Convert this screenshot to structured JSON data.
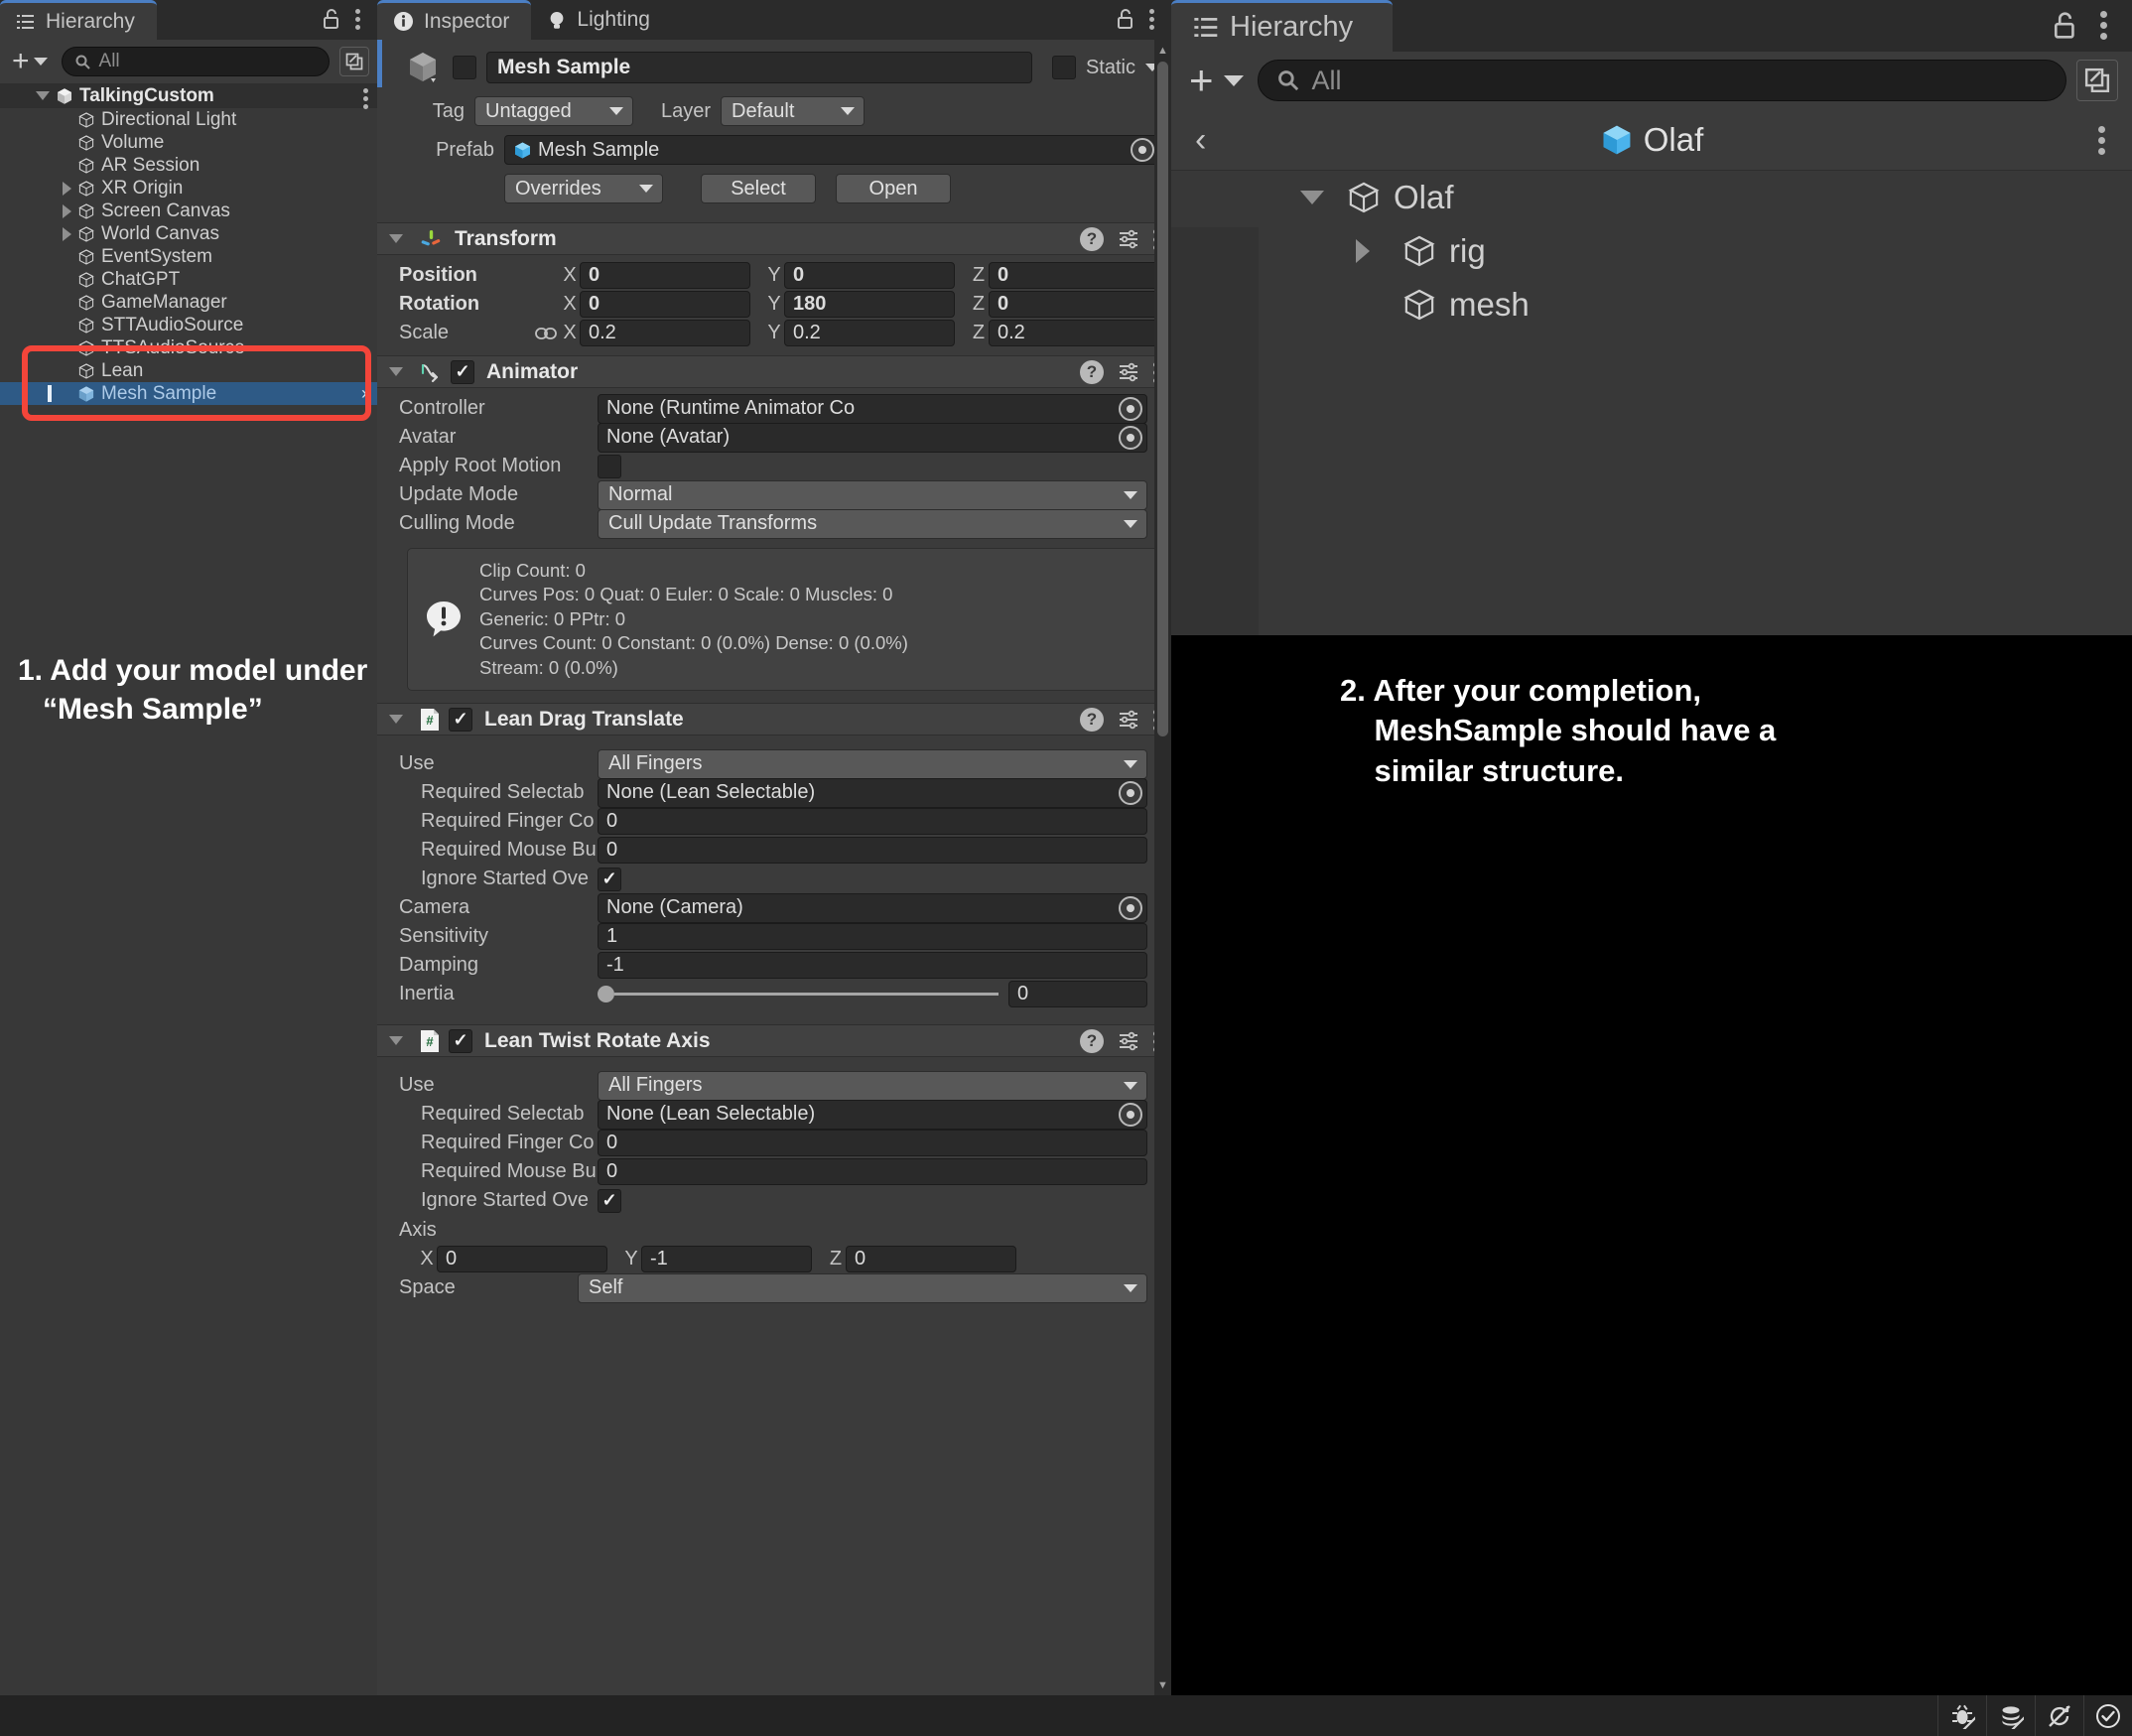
{
  "left_hierarchy": {
    "tab_label": "Hierarchy",
    "lock_icon": "lock-open-icon",
    "menu_icon": "kebab-menu-icon",
    "add_label": "+",
    "search_placeholder": "All",
    "search_icon": "search-icon",
    "open_icon": "open-in-new-icon",
    "root": {
      "label": "TalkingCustom",
      "expanded": true
    },
    "items": [
      {
        "label": "Directional Light",
        "expandable": false
      },
      {
        "label": "Volume",
        "expandable": false
      },
      {
        "label": "AR Session",
        "expandable": false
      },
      {
        "label": "XR Origin",
        "expandable": true
      },
      {
        "label": "Screen Canvas",
        "expandable": true
      },
      {
        "label": "World Canvas",
        "expandable": true
      },
      {
        "label": "EventSystem",
        "expandable": false
      },
      {
        "label": "ChatGPT",
        "expandable": false
      },
      {
        "label": "GameManager",
        "expandable": false
      },
      {
        "label": "STTAudioSource",
        "expandable": false
      },
      {
        "label": "TTSAudioSource",
        "expandable": false
      },
      {
        "label": "Lean",
        "expandable": false
      },
      {
        "label": "Mesh Sample",
        "expandable": false,
        "selected": true,
        "chevron": "›"
      }
    ]
  },
  "callout_1": "1. Add your model under\n   “Mesh Sample”",
  "callout_2": "2. After your completion,\n    MeshSample should have a\n    similar structure.",
  "inspector": {
    "tabs": [
      {
        "label": "Inspector",
        "icon": "info-circle-icon",
        "active": true
      },
      {
        "label": "Lighting",
        "icon": "lightbulb-icon",
        "active": false
      }
    ],
    "lock_icon": "lock-open-icon",
    "menu_icon": "kebab-menu-icon",
    "object_name": "Mesh Sample",
    "static_label": "Static",
    "tag_label": "Tag",
    "tag_value": "Untagged",
    "layer_label": "Layer",
    "layer_value": "Default",
    "prefab_label": "Prefab",
    "prefab_value": "Mesh Sample",
    "overrides_label": "Overrides",
    "select_label": "Select",
    "open_label": "Open",
    "transform": {
      "title": "Transform",
      "icon": "transform-axis-icon",
      "rows": [
        {
          "name": "Position",
          "bold": true,
          "link": false,
          "x": "0",
          "y": "0",
          "z": "0"
        },
        {
          "name": "Rotation",
          "bold": true,
          "link": false,
          "x": "0",
          "y": "180",
          "z": "0"
        },
        {
          "name": "Scale",
          "bold": false,
          "link": true,
          "x": "0.2",
          "y": "0.2",
          "z": "0.2"
        }
      ],
      "axis_labels": [
        "X",
        "Y",
        "Z"
      ]
    },
    "animator": {
      "title": "Animator",
      "icon": "animator-icon",
      "enabled": true,
      "fields": [
        {
          "label": "Controller",
          "type": "object",
          "value": "None (Runtime Animator Co"
        },
        {
          "label": "Avatar",
          "type": "object",
          "value": "None (Avatar)"
        },
        {
          "label": "Apply Root Motion",
          "type": "checkbox",
          "value": false
        },
        {
          "label": "Update Mode",
          "type": "dropdown",
          "value": "Normal"
        },
        {
          "label": "Culling Mode",
          "type": "dropdown",
          "value": "Cull Update Transforms"
        }
      ],
      "info_icon": "warning-exclamation-icon",
      "info_lines": [
        "Clip Count: 0",
        "Curves Pos: 0 Quat: 0 Euler: 0 Scale: 0 Muscles: 0",
        "Generic: 0 PPtr: 0",
        "Curves Count: 0 Constant: 0 (0.0%) Dense: 0 (0.0%)",
        "Stream: 0 (0.0%)"
      ]
    },
    "lean_drag_translate": {
      "title": "Lean Drag Translate",
      "icon": "script-hash-icon",
      "enabled": true,
      "fields": [
        {
          "label": "Use",
          "indent": 0,
          "type": "dropdown",
          "value": "All Fingers"
        },
        {
          "label": "Required Selectab",
          "indent": 1,
          "type": "object",
          "value": "None (Lean Selectable)"
        },
        {
          "label": "Required Finger Co",
          "indent": 1,
          "type": "number",
          "value": "0"
        },
        {
          "label": "Required Mouse Bu",
          "indent": 1,
          "type": "number",
          "value": "0"
        },
        {
          "label": "Ignore Started Ove",
          "indent": 1,
          "type": "checkbox",
          "value": true
        },
        {
          "label": "Camera",
          "indent": 0,
          "type": "object",
          "value": "None (Camera)"
        },
        {
          "label": "Sensitivity",
          "indent": 0,
          "type": "number",
          "value": "1"
        },
        {
          "label": "Damping",
          "indent": 0,
          "type": "number",
          "value": "-1"
        },
        {
          "label": "Inertia",
          "indent": 0,
          "type": "slider",
          "value": "0"
        }
      ]
    },
    "lean_twist_rotate_axis": {
      "title": "Lean Twist Rotate Axis",
      "icon": "script-hash-icon",
      "enabled": true,
      "fields": [
        {
          "label": "Use",
          "indent": 0,
          "type": "dropdown",
          "value": "All Fingers"
        },
        {
          "label": "Required Selectab",
          "indent": 1,
          "type": "object",
          "value": "None (Lean Selectable)"
        },
        {
          "label": "Required Finger Co",
          "indent": 1,
          "type": "number",
          "value": "0"
        },
        {
          "label": "Required Mouse Bu",
          "indent": 1,
          "type": "number",
          "value": "0"
        },
        {
          "label": "Ignore Started Ove",
          "indent": 1,
          "type": "checkbox",
          "value": true
        }
      ],
      "axis_label": "Axis",
      "axis_labels": [
        "X",
        "Y",
        "Z"
      ],
      "axis": {
        "x": "0",
        "y": "-1",
        "z": "0"
      },
      "space_label": "Space",
      "space_value": "Self"
    }
  },
  "right_hierarchy": {
    "tab_label": "Hierarchy",
    "lock_icon": "lock-open-icon",
    "menu_icon": "kebab-menu-icon",
    "add_label": "+",
    "search_placeholder": "All",
    "search_icon": "search-icon",
    "open_icon": "open-in-new-icon",
    "breadcrumb": {
      "back_icon": "chevron-left-icon",
      "label": "Olaf",
      "menu_icon": "kebab-menu-icon"
    },
    "items": [
      {
        "label": "Olaf",
        "depth": 0,
        "expandable": true,
        "expanded": true
      },
      {
        "label": "rig",
        "depth": 1,
        "expandable": true,
        "expanded": false
      },
      {
        "label": "mesh",
        "depth": 1,
        "expandable": false,
        "expanded": false
      }
    ]
  },
  "statusbar": {
    "buttons": [
      {
        "icon": "bug-muted-icon"
      },
      {
        "icon": "layers-muted-icon"
      },
      {
        "icon": "refresh-muted-icon"
      },
      {
        "icon": "check-circle-icon"
      }
    ]
  },
  "colors": {
    "selection_blue": "#2e5a86",
    "accent_red": "#f4453a",
    "tab_accent": "#4b7fc4",
    "prefab_blue": "#58b9f0"
  }
}
